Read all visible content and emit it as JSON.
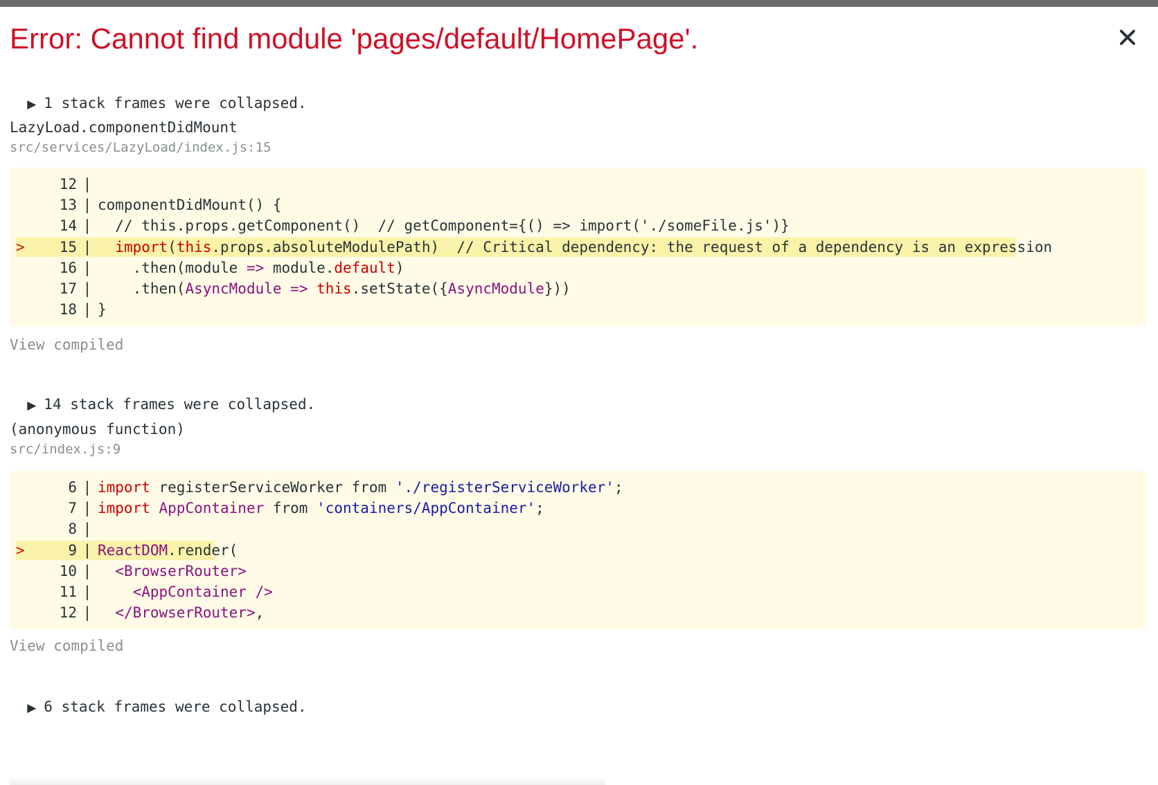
{
  "error": {
    "title": "Error: Cannot find module 'pages/default/HomePage'.",
    "close_label": "×"
  },
  "frames": {
    "collapsed_1": "1 stack frames were collapsed.",
    "frame1": {
      "function": "LazyLoad.componentDidMount",
      "location": "src/services/LazyLoad/index.js:15",
      "lines": [
        {
          "num": "12",
          "marker": " ",
          "tokens": [
            {
              "t": "",
              "c": "p"
            }
          ]
        },
        {
          "num": "13",
          "marker": " ",
          "tokens": [
            {
              "t": "componentDidMount() {",
              "c": "p"
            }
          ]
        },
        {
          "num": "14",
          "marker": " ",
          "tokens": [
            {
              "t": "  // this.props.getComponent()  // getComponent={() => import('./someFile.js')}",
              "c": "p"
            }
          ]
        },
        {
          "num": "15",
          "marker": ">",
          "tokens": [
            {
              "t": "  ",
              "c": "p"
            },
            {
              "t": "import",
              "c": "r"
            },
            {
              "t": "(",
              "c": "p"
            },
            {
              "t": "this",
              "c": "r"
            },
            {
              "t": ".props.absoluteModulePath)  // Critical dependency: the request of a dependency is an expression",
              "c": "p"
            }
          ]
        },
        {
          "num": "16",
          "marker": " ",
          "tokens": [
            {
              "t": "    .then(module ",
              "c": "p"
            },
            {
              "t": "=>",
              "c": "k"
            },
            {
              "t": " module.",
              "c": "p"
            },
            {
              "t": "default",
              "c": "r"
            },
            {
              "t": ")",
              "c": "p"
            }
          ]
        },
        {
          "num": "17",
          "marker": " ",
          "tokens": [
            {
              "t": "    .then(",
              "c": "p"
            },
            {
              "t": "AsyncModule",
              "c": "k"
            },
            {
              "t": " ",
              "c": "p"
            },
            {
              "t": "=>",
              "c": "k"
            },
            {
              "t": " ",
              "c": "p"
            },
            {
              "t": "this",
              "c": "r"
            },
            {
              "t": ".setState({",
              "c": "p"
            },
            {
              "t": "AsyncModule",
              "c": "k"
            },
            {
              "t": "}))",
              "c": "p"
            }
          ]
        },
        {
          "num": "18",
          "marker": " ",
          "tokens": [
            {
              "t": "}",
              "c": "p"
            }
          ]
        }
      ],
      "view_compiled": "View compiled"
    },
    "collapsed_2": "14 stack frames were collapsed.",
    "frame2": {
      "function": "(anonymous function)",
      "location": "src/index.js:9",
      "lines": [
        {
          "num": "6",
          "marker": " ",
          "tokens": [
            {
              "t": "import",
              "c": "r"
            },
            {
              "t": " registerServiceWorker from ",
              "c": "p"
            },
            {
              "t": "'./registerServiceWorker'",
              "c": "s"
            },
            {
              "t": ";",
              "c": "p"
            }
          ]
        },
        {
          "num": "7",
          "marker": " ",
          "tokens": [
            {
              "t": "import",
              "c": "r"
            },
            {
              "t": " ",
              "c": "p"
            },
            {
              "t": "AppContainer",
              "c": "k"
            },
            {
              "t": " from ",
              "c": "p"
            },
            {
              "t": "'containers/AppContainer'",
              "c": "s"
            },
            {
              "t": ";",
              "c": "p"
            }
          ]
        },
        {
          "num": "8",
          "marker": " ",
          "tokens": [
            {
              "t": "",
              "c": "p"
            }
          ]
        },
        {
          "num": "9",
          "marker": ">",
          "tokens": [
            {
              "t": "ReactDOM",
              "c": "k"
            },
            {
              "t": ".render(",
              "c": "p"
            }
          ]
        },
        {
          "num": "10",
          "marker": " ",
          "tokens": [
            {
              "t": "  ",
              "c": "p"
            },
            {
              "t": "<BrowserRouter>",
              "c": "k"
            }
          ]
        },
        {
          "num": "11",
          "marker": " ",
          "tokens": [
            {
              "t": "    ",
              "c": "p"
            },
            {
              "t": "<AppContainer />",
              "c": "k"
            }
          ]
        },
        {
          "num": "12",
          "marker": " ",
          "tokens": [
            {
              "t": "  ",
              "c": "p"
            },
            {
              "t": "</BrowserRouter>",
              "c": "k"
            },
            {
              "t": ",",
              "c": "p"
            }
          ]
        }
      ],
      "view_compiled": "View compiled"
    },
    "collapsed_3": "6 stack frames were collapsed."
  }
}
